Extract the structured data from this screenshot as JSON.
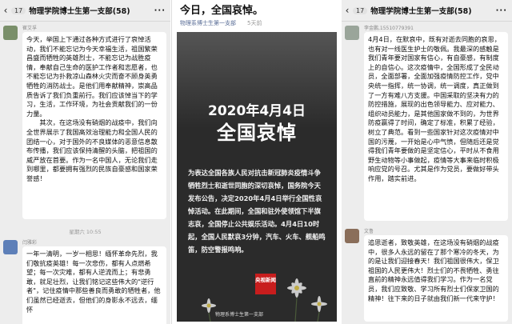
{
  "left": {
    "header": {
      "back": "‹",
      "count": "17",
      "title": "物理学院博士生第一支部(58)",
      "menu": "···"
    },
    "msg1": {
      "name": "崔艾孚",
      "text": "今天，举国上下通过各种方式进行了哀悼活动，我们不能忘记为今天幸福生活，祖国繁荣昌盛而牺牲的英雄烈士，不能忘记为战胜疫情，奉献自己生命的医护工作者和志愿者，也不能忘记为扑救凉山森林火灾而奋不顾身英勇牺牲的消防战士。是他们用奉献精神，崇高品质告诉了我们负重前行。我们应该悼当下的学习，生活，工作环境，为社会贡献我们的一份力量。\n　　其次，在这场没有硝烟的战疫中，我们向全世界展示了我国高效治理能力和全国人民的团结一心，对于国外的不良媒体的恶意信息散布传播，我们应该保持清醒的头脑，把祖国的威严放在首要。作为一名中国人，无论我们走到哪里，都要拥有强烈的民族自豪感和国家荣誉感！"
    },
    "timestamp": "星期六 10:55",
    "msg2": {
      "name": "闫雅彩",
      "text": "一年一清明，一岁一相思！缅怀革命先烈，我们敬抗疫英雄！每一次悲伤，都有人点燃希望；每一次灾难，都有人逆流而上；有悲勇敢，就足壮烈，让我们铭记这些伟大的\"逆行者\"，记住疫情中那些善良而勇敢的牺牲者，他们虽然已经逝去，但他们的身影永不远去，缅怀"
    }
  },
  "mid": {
    "title": "今日，全国哀悼。",
    "source": "物理系博士生第一支部",
    "time": "5天前",
    "poster": {
      "date": "2020年4月4日",
      "headline": "全国哀悼",
      "body": "为表达全国各族人民对抗击新冠肺炎疫情斗争牺牲烈士和逝世同胞的深切哀悼，国务院今天发布公告，决定2020年4月4日举行全国性哀悼活动。在此期间，全国和驻外使领馆下半旗志哀，全国停止公共娱乐活动。4月4日10时起，全国人民默哀3分钟，汽车、火车、舰船鸣笛，防空警报鸣响。",
      "logo": "央视新闻",
      "credit": "物理系博士生第一支部"
    }
  },
  "right": {
    "header": {
      "back": "‹",
      "count": "17",
      "title": "物理学院博士生第一支部(58)",
      "menu": "···"
    },
    "msg1": {
      "name": "李金鹏,15510779391",
      "text": "4月4日，在默哀中，既有对逝去同胞的哀思，也有对一线医生护士的敬佩。我最深的感触是我们青年要对国家有信心，有自豪感，有制度上的自信心。这次疫情中，全国形成了全民动员，全面部署，全面加强疫情防控工作，党中央统一指挥，统一协调，统一调度，真正做到了一方有难八方支援。中国采取的坚决有力的防控措施，展现的出色领导能力、应对能力、组织动员能力，是其他国家做不到的，为世界防疫赢得了时间，确定了标准，积累了经验，树立了典范。看到一些国家针对这次疫情对中国的污蔑，一开始是心中气愤，但随后还是觉得我们青年要做的是坚定信心，平时从不食用野生动物等小事做起，疫情等大事来临时积极响应党的号召。尤其是作为党员，要做好带头作用，踏实前进。"
    },
    "msg2": {
      "name": "文鲁",
      "text": "追思逝者，致敬英雄，在这场没有硝烟的战疫中，很多人永远的留在了那个寒冷的冬天，为的是让我们迎接春天！我们祖国很伟大，保卫祖国的人民更伟大！烈士们的不畏牺牲、勇往直前的精神永远值得我们学习。作为一名党员，我们应致敬、学习所有烈士们保家卫国的精神！往下来的日子就由我们新一代来守护！"
    }
  },
  "colors": {
    "chat_bg": "#ededed",
    "bubble": "#ffffff",
    "link": "#576b95",
    "poster_bg": "#2b2b2b",
    "logo_red": "#c81d1d"
  }
}
